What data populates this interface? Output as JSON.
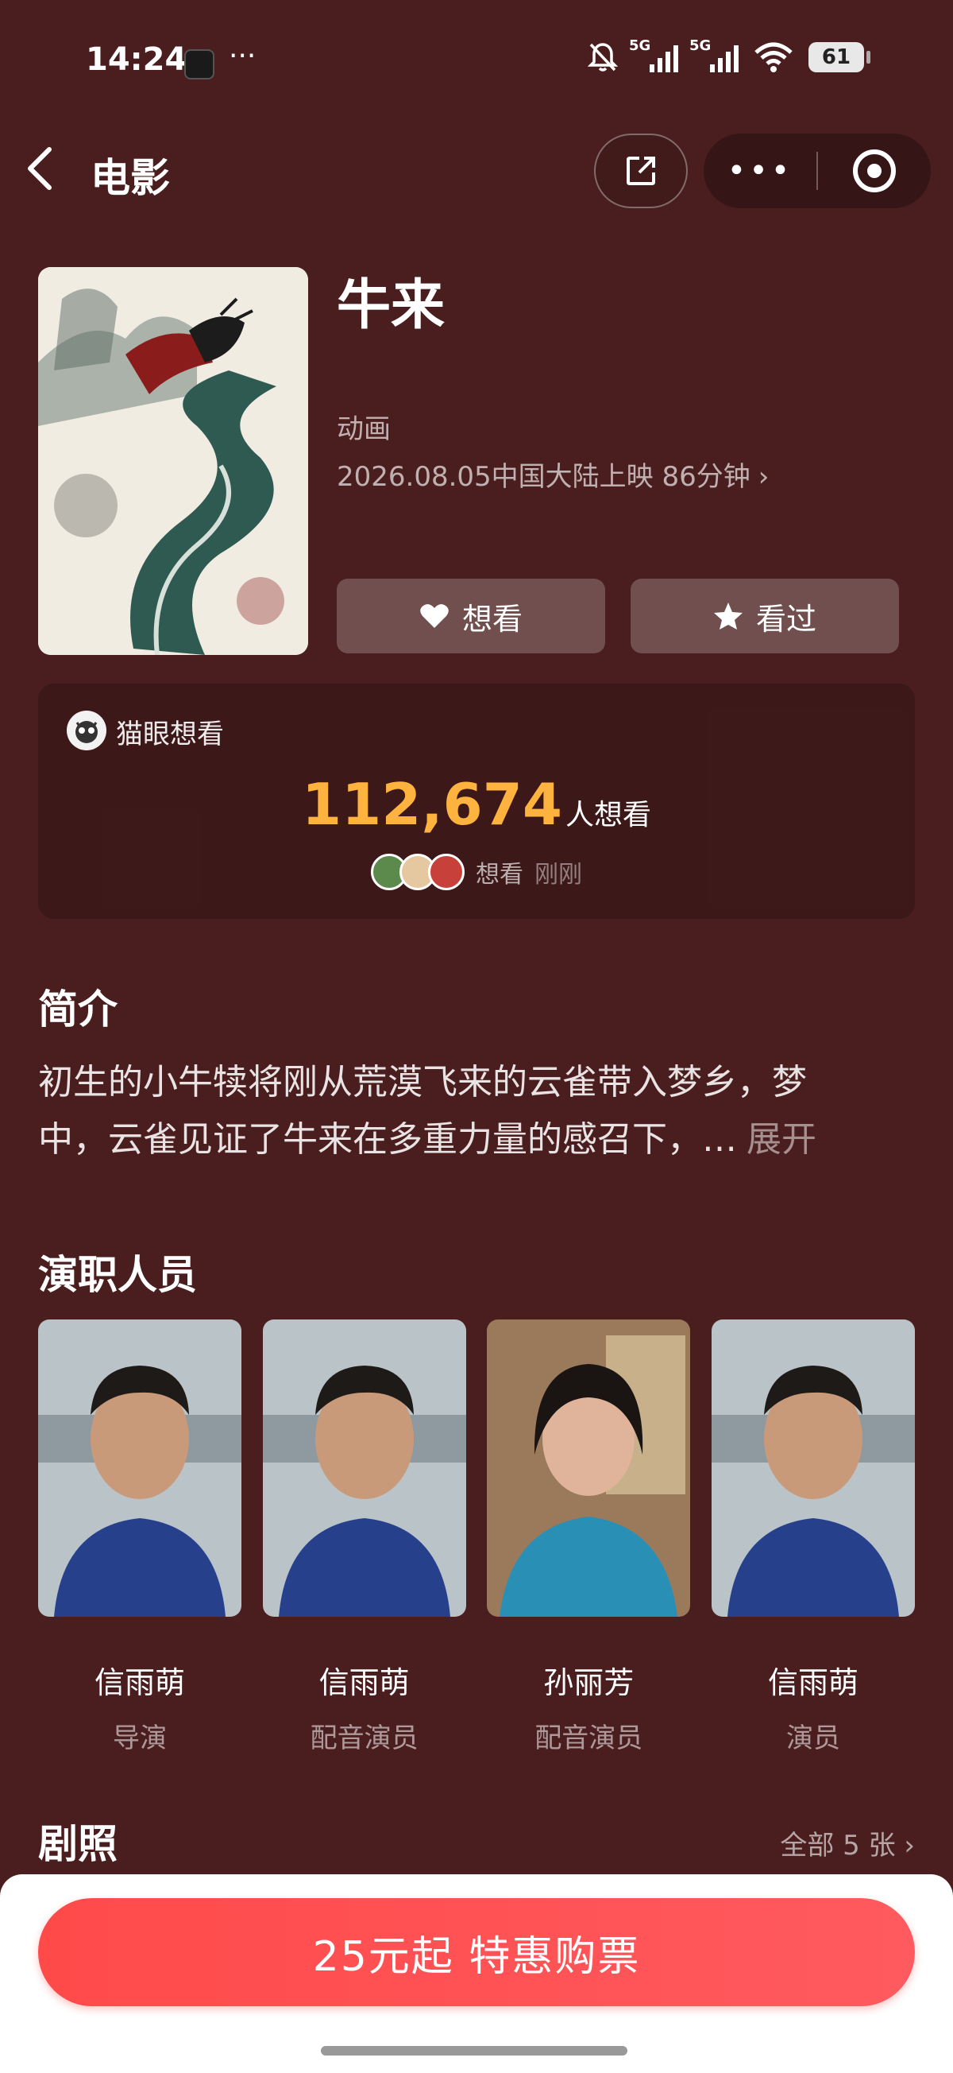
{
  "status": {
    "time": "14:24",
    "net1": "5G",
    "net2": "5G",
    "battery": "61"
  },
  "nav": {
    "title": "电影"
  },
  "movie": {
    "title": "牛来",
    "genre": "动画",
    "release": "2026.08.05中国大陆上映 86分钟",
    "want_label": "想看",
    "seen_label": "看过"
  },
  "want": {
    "source": "猫眼想看",
    "count": "112,674",
    "unit": "人想看",
    "recent_action": "想看",
    "recent_time": "刚刚"
  },
  "synopsis": {
    "title": "简介",
    "line1": "初生的小牛犊将刚从荒漠飞来的云雀带入梦乡，梦",
    "line2": "中，云雀见证了牛来在多重力量的感召下，…",
    "expand": "展开"
  },
  "cast": {
    "title": "演职人员",
    "members": [
      {
        "name": "信雨萌",
        "role": "导演"
      },
      {
        "name": "信雨萌",
        "role": "配音演员"
      },
      {
        "name": "孙丽芳",
        "role": "配音演员"
      },
      {
        "name": "信雨萌",
        "role": "演员"
      }
    ]
  },
  "stills": {
    "title": "剧照",
    "all_label": "全部 5 张"
  },
  "buy": {
    "label": "25元起 特惠购票"
  },
  "colors": {
    "background": "#4a1e1e",
    "accent_count": "#ffb33f",
    "buy_button": "#ff4a4a"
  }
}
